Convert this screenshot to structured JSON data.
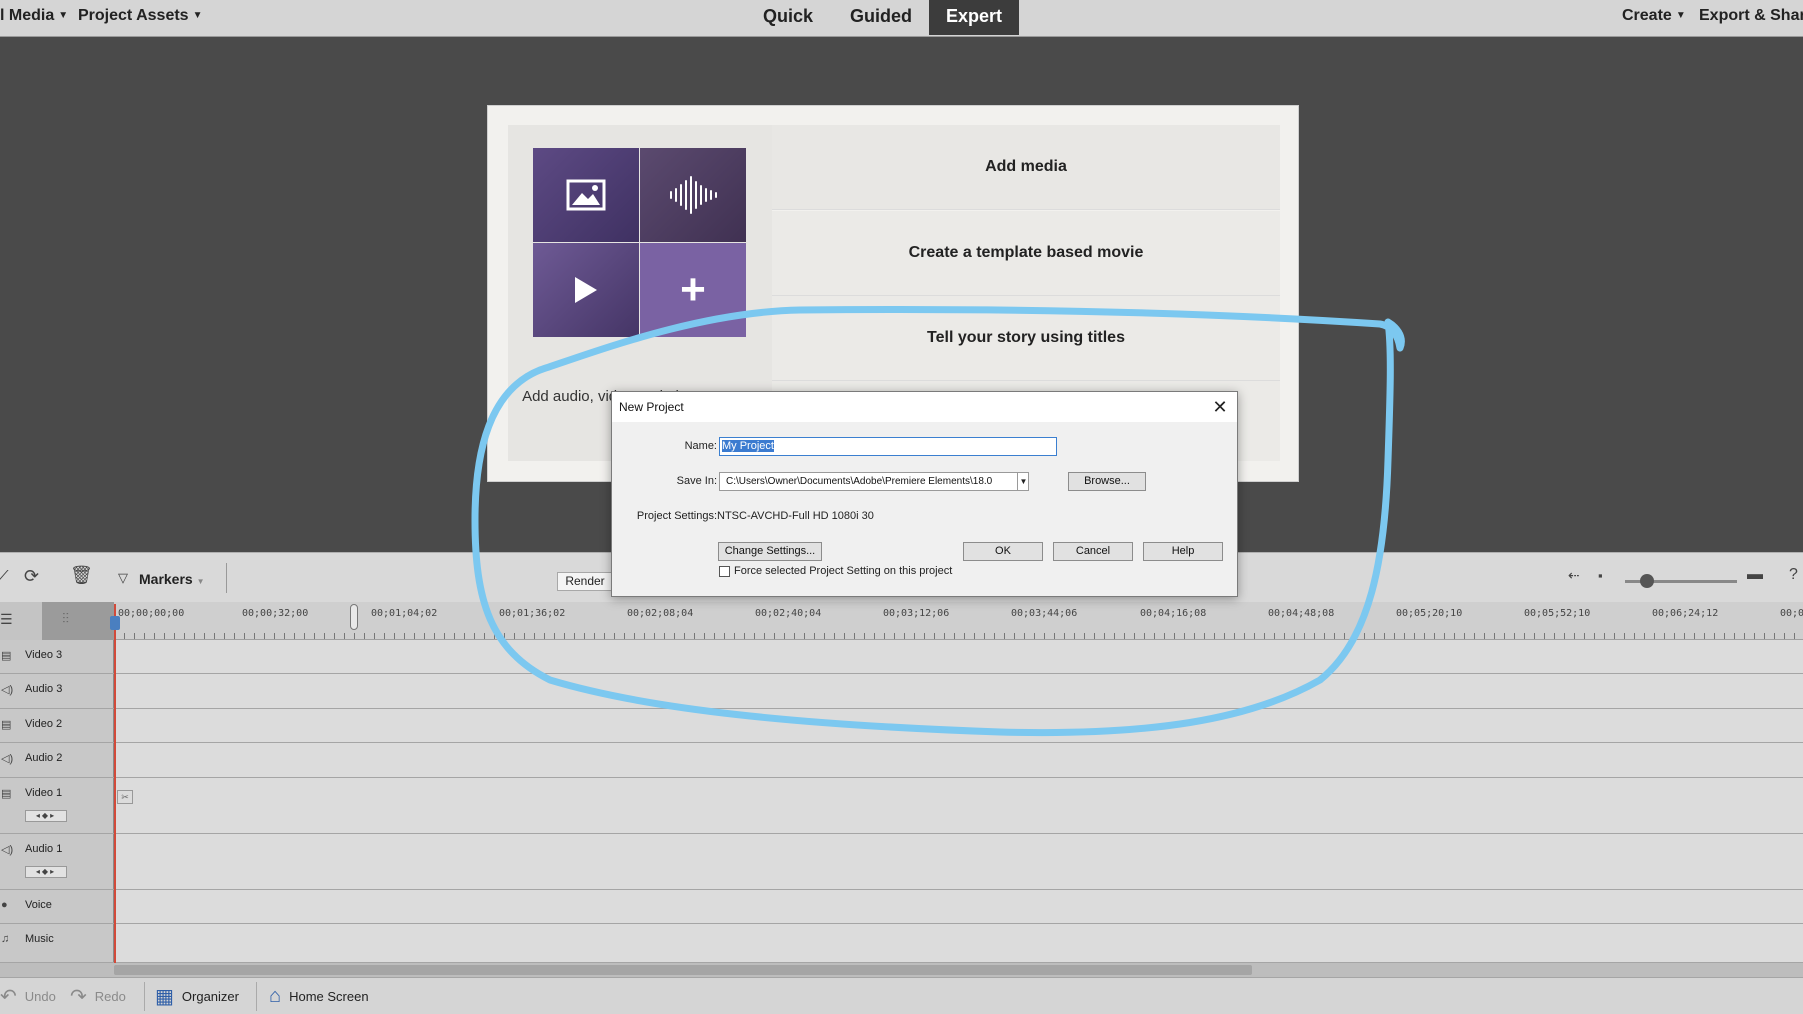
{
  "topbar": {
    "menu_media": "l Media",
    "menu_project_assets": "Project Assets",
    "modes": {
      "quick": "Quick",
      "guided": "Guided",
      "expert": "Expert"
    },
    "menu_create": "Create",
    "menu_export": "Export & Share"
  },
  "welcome": {
    "text": "Add audio, video and photos to get started",
    "options": {
      "add_media": "Add media",
      "template": "Create a template based movie",
      "titles": "Tell your story using titles"
    }
  },
  "timeline": {
    "markers_label": "Markers",
    "render_label": "Render",
    "ruler": [
      "00;00;00;00",
      "00;00;32;00",
      "00;01;04;02",
      "00;01;36;02",
      "00;02;08;04",
      "00;02;40;04",
      "00;03;12;06",
      "00;03;44;06",
      "00;04;16;08",
      "00;04;48;08",
      "00;05;20;10",
      "00;05;52;10",
      "00;06;24;12",
      "00;0"
    ],
    "tracks": {
      "video3": "Video 3",
      "audio3": "Audio 3",
      "video2": "Video 2",
      "audio2": "Audio 2",
      "video1": "Video 1",
      "audio1": "Audio 1",
      "voice": "Voice",
      "music": "Music"
    }
  },
  "bottombar": {
    "undo": "Undo",
    "redo": "Redo",
    "organizer": "Organizer",
    "home": "Home Screen"
  },
  "dialog": {
    "title": "New Project",
    "name_label": "Name:",
    "name_value": "My Project",
    "savein_label": "Save In:",
    "savein_value": "C:\\Users\\Owner\\Documents\\Adobe\\Premiere Elements\\18.0",
    "browse_label": "Browse...",
    "settings_label": "Project Settings:",
    "settings_value": "NTSC-AVCHD-Full HD 1080i 30",
    "change_settings_label": "Change Settings...",
    "ok_label": "OK",
    "cancel_label": "Cancel",
    "help_label": "Help",
    "force_label": "Force selected Project Setting on this project"
  },
  "colors": {
    "annotation": "#7cc8f0",
    "expert_tab": "#3c3c3c",
    "tile_accent": "#7a62a3",
    "playhead": "#d24a3a"
  }
}
